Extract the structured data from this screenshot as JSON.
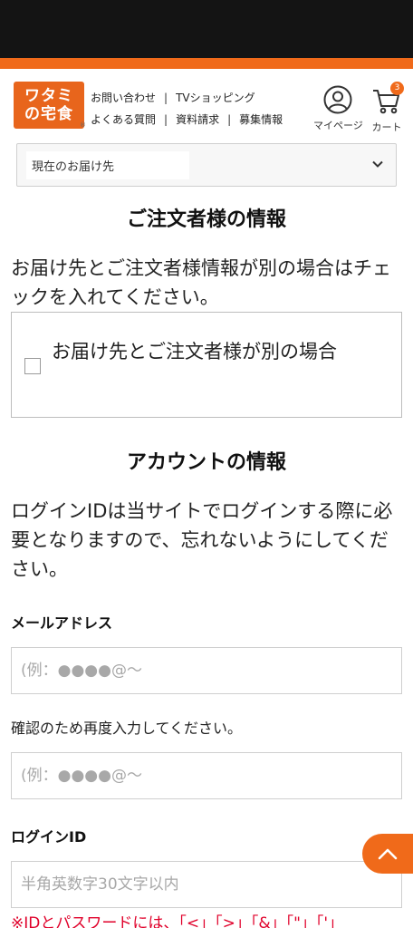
{
  "header": {
    "logo_line1": "ワタミ",
    "logo_line2": "の宅食",
    "logo_mark": "®",
    "nav": [
      [
        "お問い合わせ",
        "TVショッピング"
      ],
      [
        "よくある質問",
        "資料請求",
        "募集情報"
      ]
    ],
    "nav_separator": "|",
    "mypage_label": "マイページ",
    "cart_label": "カート",
    "cart_count": "3"
  },
  "delivery": {
    "selected": "現在のお届け先"
  },
  "orderer": {
    "title": "ご注文者様の情報",
    "description": "お届け先とご注文者様情報が別の場合はチェックを入れてください。",
    "checkbox_label": "お届け先とご注文者様が別の場合"
  },
  "account": {
    "title": "アカウントの情報",
    "description": "ログインIDは当サイトでログインする際に必要となりますので、忘れないようにしてください。",
    "email_label": "メールアドレス",
    "email_placeholder": "(例：●●●●@〜",
    "confirm_label": "確認のため再度入力してください。",
    "confirm_placeholder": "(例：●●●●@〜",
    "login_id_label": "ログインID",
    "login_id_placeholder": "半角英数字30文字以内",
    "note": "※IDとパスワードには、「<」「>」「&」「\"」「'」"
  },
  "colors": {
    "accent": "#f06a1a",
    "status_bar": "#141414",
    "note": "#e0002a"
  },
  "icons": [
    "user-icon",
    "cart-icon",
    "chevron-down-icon",
    "chevron-up-icon"
  ]
}
